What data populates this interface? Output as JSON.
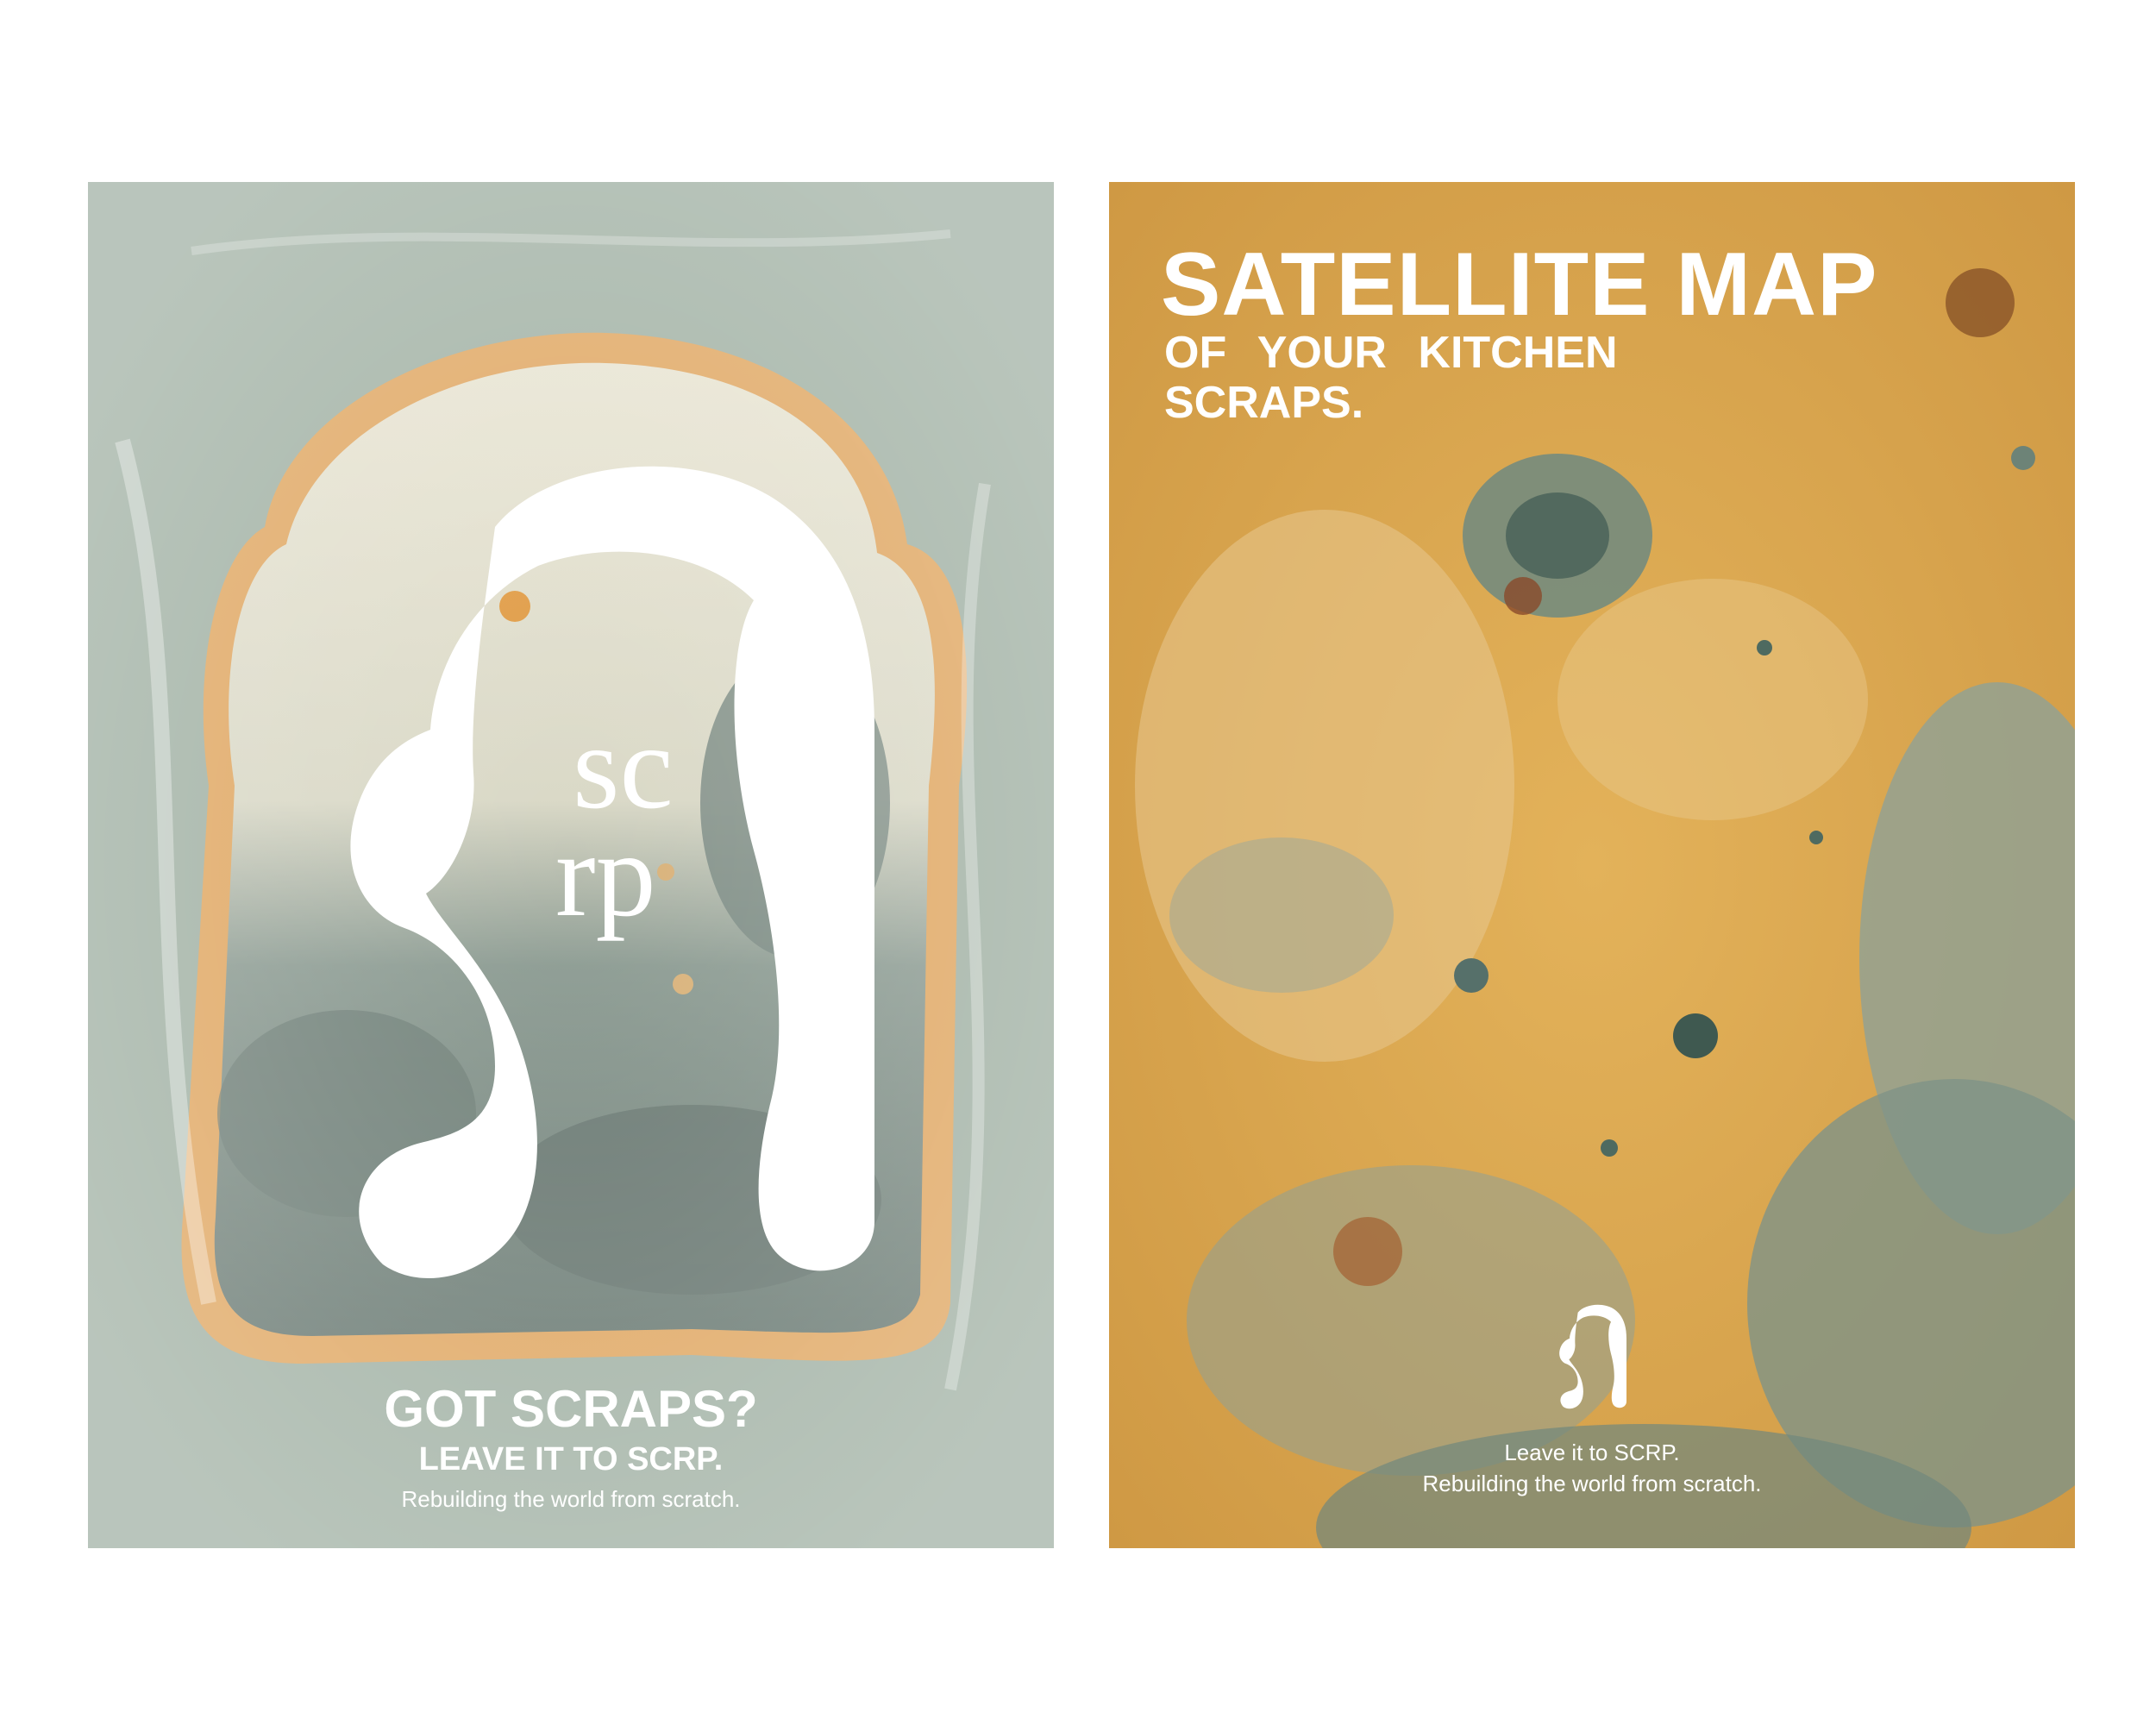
{
  "left_poster": {
    "logo_text": "scrp",
    "headline": "GOT SCRAPS?",
    "subheadline": "LEAVE IT TO SCRP.",
    "tagline": "Rebuilding the world from scratch."
  },
  "right_poster": {
    "title": "SATELLITE MAP",
    "subtitle_line1": "OF YOUR KITCHEN",
    "subtitle_line2": "SCRAPS.",
    "logo_text": "scrp",
    "tagline_line1": "Leave it to SCRP.",
    "tagline_line2": "Rebuilding the world from scratch."
  },
  "colors": {
    "background": "#ffffff",
    "left_backdrop": "#a2b2a5",
    "bread_crust": "#e0a864",
    "bread_crumb": "#e8e4d2",
    "mold_grey": "#6f7f78",
    "right_bread": "#d9a54c",
    "mold_green": "#7f9e8f",
    "text": "#ffffff"
  }
}
